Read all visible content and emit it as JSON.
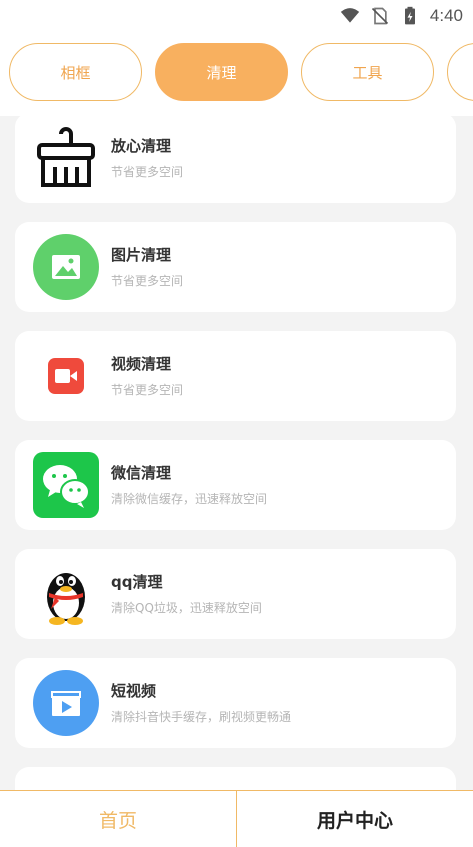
{
  "status": {
    "time": "4:40",
    "icons": [
      "wifi-icon",
      "no-sim-icon",
      "battery-icon"
    ]
  },
  "tabs": [
    {
      "label": "相框",
      "active": false
    },
    {
      "label": "清理",
      "active": true
    },
    {
      "label": "工具",
      "active": false
    },
    {
      "label": "",
      "active": false
    }
  ],
  "items": [
    {
      "title": "放心清理",
      "subtitle": "节省更多空间",
      "icon": "broom-icon"
    },
    {
      "title": "图片清理",
      "subtitle": "节省更多空间",
      "icon": "image-icon"
    },
    {
      "title": "视频清理",
      "subtitle": "节省更多空间",
      "icon": "video-icon"
    },
    {
      "title": "微信清理",
      "subtitle": "清除微信缓存，迅速释放空间",
      "icon": "wechat-icon"
    },
    {
      "title": "qq清理",
      "subtitle": "清除QQ垃圾，迅速释放空间",
      "icon": "qq-penguin-icon"
    },
    {
      "title": "短视频",
      "subtitle": "清除抖音快手缓存，刷视频更畅通",
      "icon": "short-video-icon"
    }
  ],
  "bottom_nav": {
    "home": "首页",
    "user_center": "用户中心"
  },
  "colors": {
    "accent": "#f8b05f",
    "accent_border": "#f0b966",
    "background": "#f3f3f3"
  }
}
